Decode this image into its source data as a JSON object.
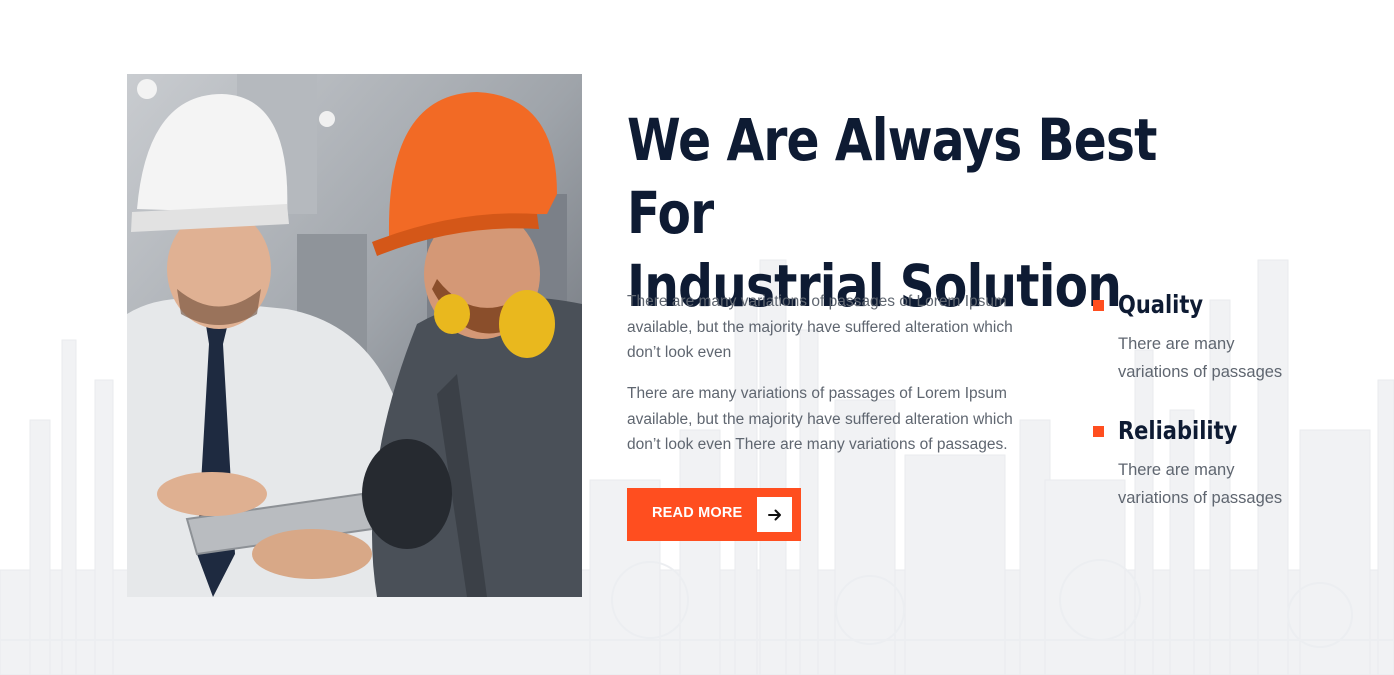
{
  "about": {
    "image_description": "two-workers-hardhats-tablet",
    "headline_line1": "We Are Always Best For",
    "headline_line2": "Industrial Solution",
    "paragraph1": "There are many variations of passages of Lorem Ipsum available, but the majority have suffered alteration which don’t look even",
    "paragraph2": "There are many variations of passages of Lorem Ipsum available, but the majority have suffered alteration which don’t look even There are many variations of passages.",
    "button_label": "READ MORE",
    "button_icon": "arrow-right-icon"
  },
  "features": [
    {
      "title": "Quality",
      "text": "There are many variations of passages",
      "icon": "square-bullet-icon"
    },
    {
      "title": "Reliability",
      "text": "There are many variations of passages",
      "icon": "square-bullet-icon"
    }
  ],
  "colors": {
    "accent": "#ff4e1f",
    "heading": "#0e1b33",
    "body_text": "#5f6670",
    "background": "#ffffff",
    "skyline_tint": "#f0f1f3"
  }
}
